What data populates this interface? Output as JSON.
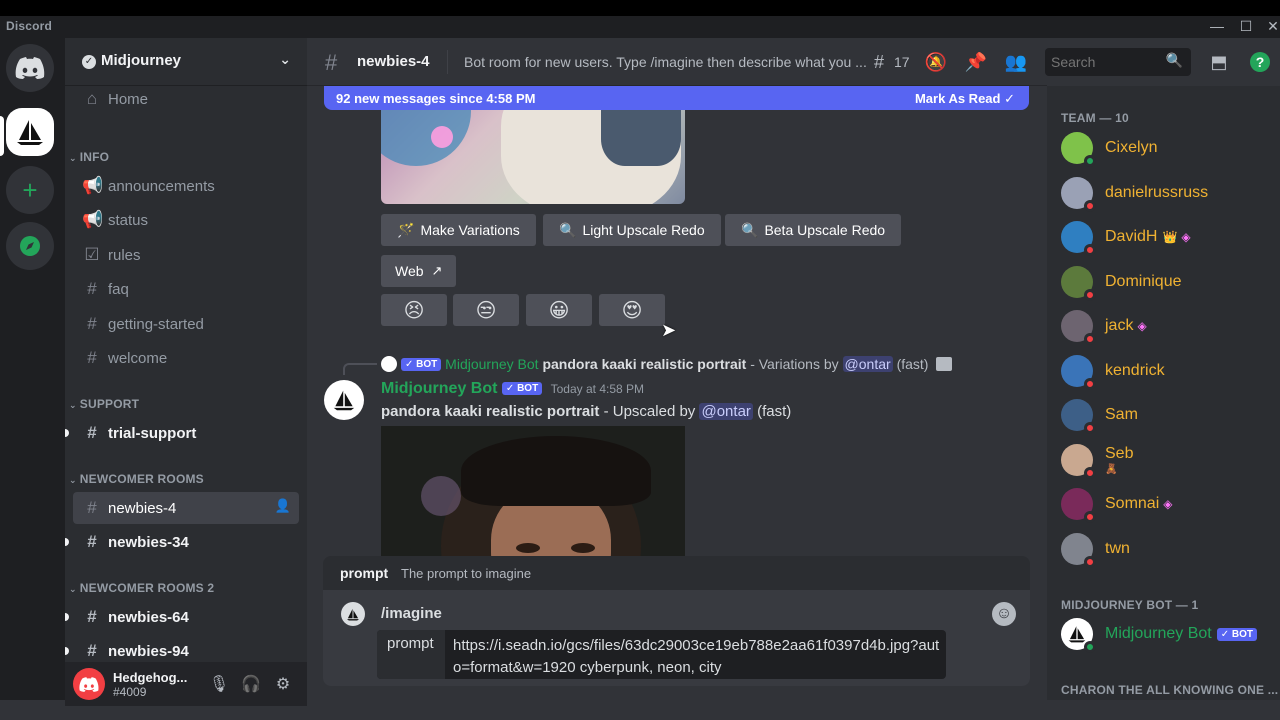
{
  "app": {
    "title": "Discord"
  },
  "server": {
    "name": "Midjourney"
  },
  "sidebar": {
    "home": "Home",
    "cat_info": "INFO",
    "info_channels": [
      "announcements",
      "status",
      "rules",
      "faq",
      "getting-started",
      "welcome"
    ],
    "cat_support": "SUPPORT",
    "support_channels": [
      "trial-support"
    ],
    "cat_newcomer": "NEWCOMER ROOMS",
    "newcomer_channels": [
      "newbies-4",
      "newbies-34"
    ],
    "cat_newcomer2": "NEWCOMER ROOMS 2",
    "newcomer2_channels": [
      "newbies-64",
      "newbies-94"
    ]
  },
  "user": {
    "name": "Hedgehog...",
    "tag": "#4009"
  },
  "header": {
    "channel": "newbies-4",
    "topic": "Bot room for new users. Type /imagine then describe what you ...",
    "threads_count": "17",
    "search_placeholder": "Search"
  },
  "banner": {
    "text": "92 new messages since 4:58 PM",
    "action": "Mark As Read"
  },
  "message1": {
    "buttons": [
      "Make Variations",
      "Light Upscale Redo",
      "Beta Upscale Redo"
    ],
    "web_button": "Web",
    "reactions": [
      "😣",
      "😒",
      "😀",
      "😍"
    ]
  },
  "message2": {
    "reply_badge": "BOT",
    "reply_author": "Midjourney Bot",
    "reply_prompt": "pandora kaaki realistic portrait",
    "reply_suffix": "- Variations by",
    "reply_mention": "@ontar",
    "reply_speed": "(fast)",
    "author": "Midjourney Bot",
    "badge": "BOT",
    "time": "Today at 4:58 PM",
    "prompt": "pandora kaaki realistic portrait",
    "suffix": "- Upscaled by",
    "mention": "@ontar",
    "speed": "(fast)"
  },
  "slash": {
    "option_name": "prompt",
    "option_desc": "The prompt to imagine",
    "command": "/imagine",
    "field_label": "prompt",
    "field_value": "https://i.seadn.io/gcs/files/63dc29003ce19eb788e2aa61f0397d4b.jpg?auto=format&w=1920 cyberpunk, neon, city"
  },
  "members": {
    "team_header": "TEAM — 10",
    "team": [
      "Cixelyn",
      "danielrussruss",
      "DavidH",
      "Dominique",
      "jack",
      "kendrick",
      "Sam",
      "Seb",
      "Somnai",
      "twn"
    ],
    "bot_header": "MIDJOURNEY BOT — 1",
    "bot_name": "Midjourney Bot",
    "bot_badge": "BOT",
    "next_header": "CHARON THE ALL KNOWING ONE ..."
  },
  "colors": {
    "accent": "#5865f2",
    "team_name": "#f0b232",
    "bot_name": "#23a55a",
    "dnd": "#f23f43",
    "online": "#23a55a"
  }
}
